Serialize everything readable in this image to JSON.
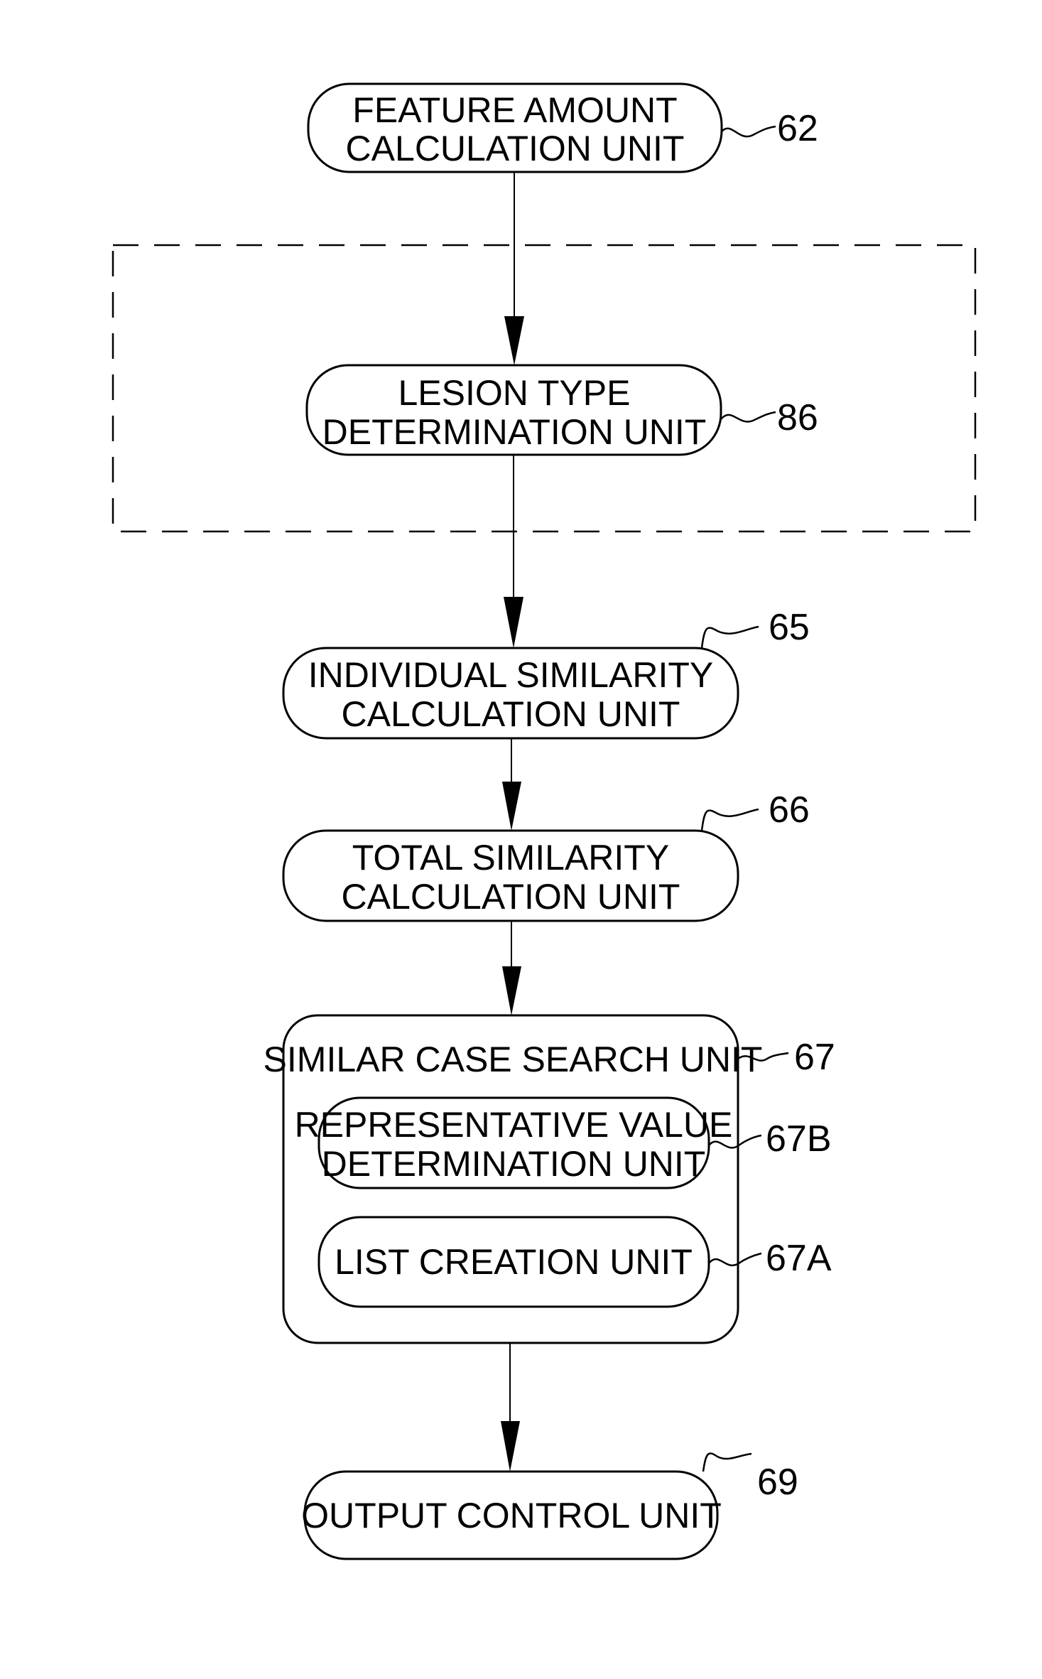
{
  "diagram": {
    "type": "block-flow",
    "nodes": {
      "n62": {
        "lines": [
          "FEATURE AMOUNT",
          "CALCULATION UNIT"
        ],
        "ref": "62"
      },
      "n86": {
        "lines": [
          "LESION TYPE",
          "DETERMINATION UNIT"
        ],
        "ref": "86"
      },
      "n65": {
        "lines": [
          "INDIVIDUAL SIMILARITY",
          "CALCULATION UNIT"
        ],
        "ref": "65"
      },
      "n66": {
        "lines": [
          "TOTAL SIMILARITY",
          "CALCULATION UNIT"
        ],
        "ref": "66"
      },
      "n67": {
        "lines": [
          "SIMILAR CASE SEARCH UNIT"
        ],
        "ref": "67"
      },
      "n67B": {
        "lines": [
          "REPRESENTATIVE VALUE",
          "DETERMINATION UNIT"
        ],
        "ref": "67B"
      },
      "n67A": {
        "lines": [
          "LIST CREATION UNIT"
        ],
        "ref": "67A"
      },
      "n69": {
        "lines": [
          "OUTPUT CONTROL UNIT"
        ],
        "ref": "69"
      }
    },
    "edges": [
      [
        "62",
        "86"
      ],
      [
        "86",
        "65"
      ],
      [
        "65",
        "66"
      ],
      [
        "66",
        "67"
      ],
      [
        "67",
        "69"
      ]
    ],
    "optional_group": {
      "contains": [
        "86"
      ],
      "style": "dashed"
    }
  }
}
